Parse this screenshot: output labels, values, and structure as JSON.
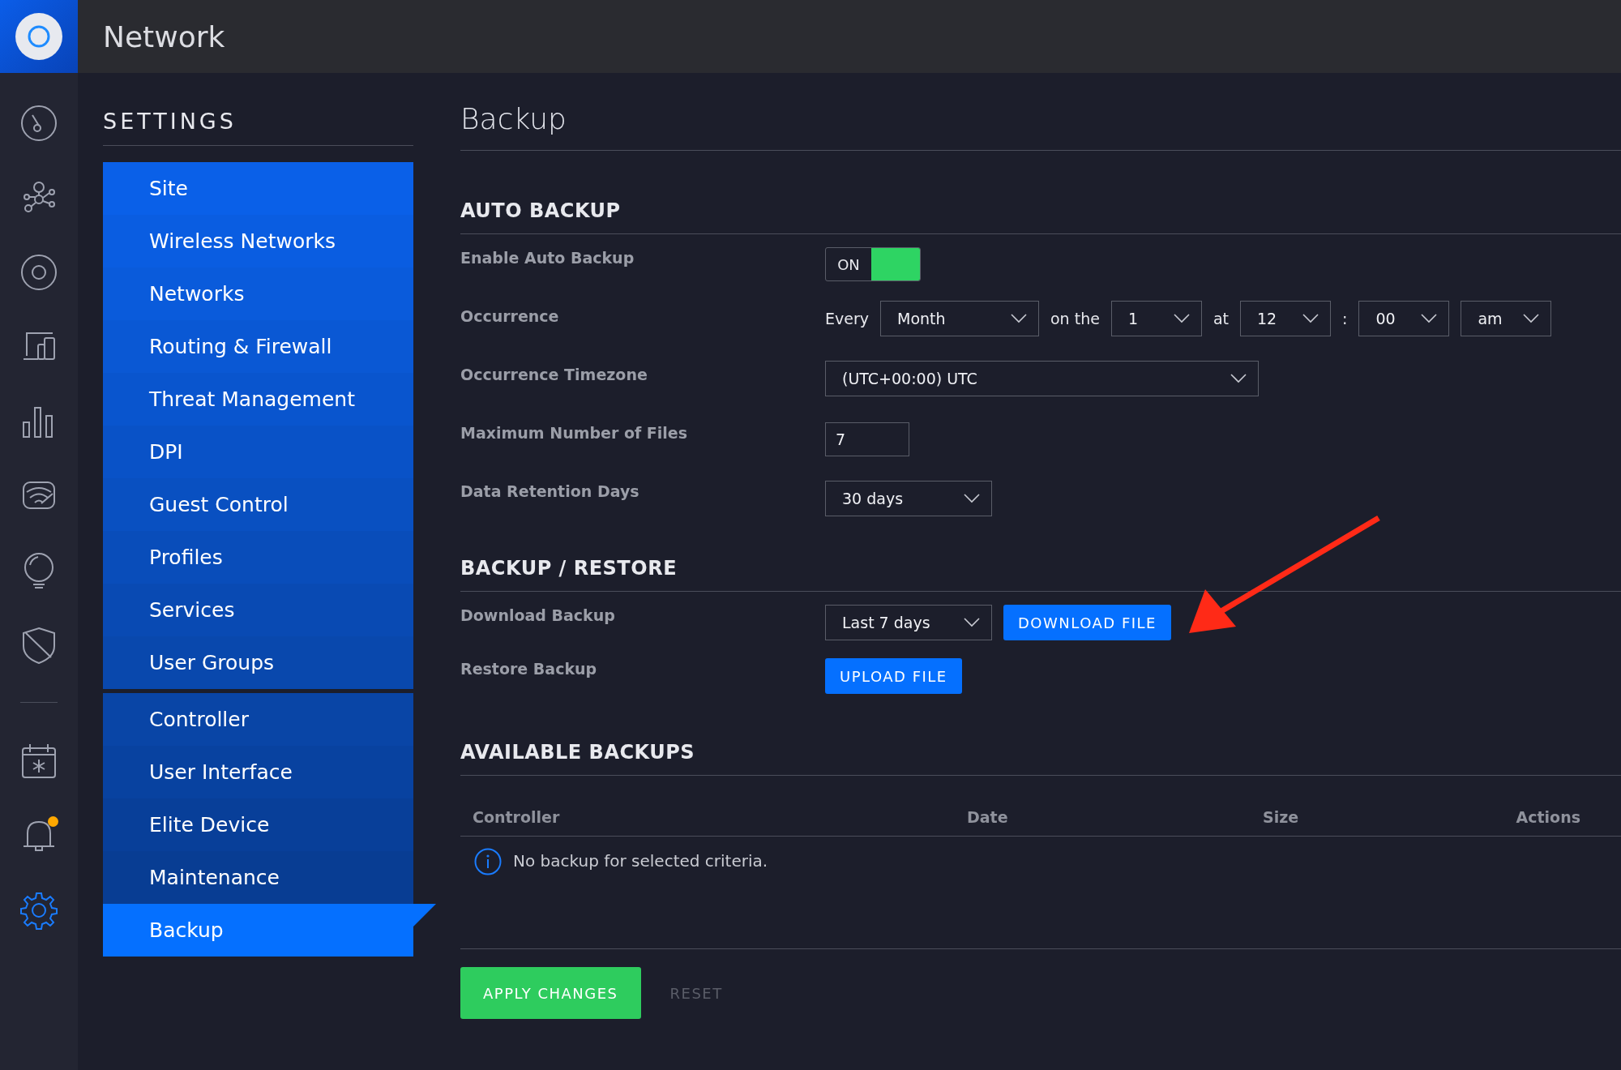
{
  "app": {
    "title": "Network"
  },
  "rail": [
    {
      "kind": "icon",
      "selected": false
    },
    {
      "kind": "icon",
      "selected": false
    },
    {
      "kind": "icon",
      "selected": false
    },
    {
      "kind": "icon",
      "selected": false
    },
    {
      "kind": "icon",
      "selected": false
    },
    {
      "kind": "icon",
      "selected": false
    },
    {
      "kind": "icon",
      "selected": false
    },
    {
      "kind": "icon",
      "selected": false
    },
    {
      "kind": "divider"
    },
    {
      "kind": "icon",
      "selected": false
    },
    {
      "kind": "icon",
      "selected": false,
      "badge": true
    },
    {
      "kind": "icon",
      "selected": true
    }
  ],
  "sidebar": {
    "title": "SETTINGS",
    "groups": [
      {
        "items": [
          {
            "label": "Site",
            "selected": false
          },
          {
            "label": "Wireless Networks",
            "selected": false
          },
          {
            "label": "Networks",
            "selected": false
          },
          {
            "label": "Routing & Firewall",
            "selected": false
          },
          {
            "label": "Threat Management",
            "selected": false
          },
          {
            "label": "DPI",
            "selected": false
          },
          {
            "label": "Guest Control",
            "selected": false
          },
          {
            "label": "Profiles",
            "selected": false
          },
          {
            "label": "Services",
            "selected": false
          },
          {
            "label": "User Groups",
            "selected": false
          }
        ]
      },
      {
        "items": [
          {
            "label": "Controller",
            "selected": false
          },
          {
            "label": "User Interface",
            "selected": false
          },
          {
            "label": "Elite Device",
            "selected": false
          },
          {
            "label": "Maintenance",
            "selected": false
          },
          {
            "label": "Backup",
            "selected": true
          }
        ]
      }
    ]
  },
  "page": {
    "title": "Backup"
  },
  "auto_backup": {
    "heading": "AUTO BACKUP",
    "enable": {
      "label": "Enable Auto Backup",
      "toggle_text": "ON",
      "on": true
    },
    "occurrence": {
      "label": "Occurrence",
      "parts": [
        {
          "kind": "text",
          "text": "Every"
        },
        {
          "kind": "select",
          "value": "Month"
        },
        {
          "kind": "text",
          "text": "on the"
        },
        {
          "kind": "select",
          "value": "1"
        },
        {
          "kind": "text",
          "text": "at"
        },
        {
          "kind": "select",
          "value": "12"
        },
        {
          "kind": "text",
          "text": ":"
        },
        {
          "kind": "select",
          "value": "00"
        },
        {
          "kind": "select",
          "value": "am"
        }
      ]
    },
    "timezone": {
      "label": "Occurrence Timezone",
      "value": "(UTC+00:00) UTC"
    },
    "max_files": {
      "label": "Maximum Number of Files",
      "value": "7"
    },
    "retention": {
      "label": "Data Retention Days",
      "value": "30 days"
    }
  },
  "backup_restore": {
    "heading": "BACKUP / RESTORE",
    "download": {
      "label": "Download Backup",
      "range": "Last 7 days",
      "button": "DOWNLOAD FILE"
    },
    "restore": {
      "label": "Restore Backup",
      "button": "UPLOAD FILE"
    }
  },
  "available": {
    "heading": "AVAILABLE BACKUPS",
    "columns": [
      "Controller",
      "Date",
      "Size",
      "Actions"
    ],
    "empty_message": "No backup for selected criteria."
  },
  "footer": {
    "apply": {
      "label": "APPLY CHANGES",
      "disabled": false
    },
    "reset": {
      "label": "RESET",
      "disabled": true
    }
  }
}
